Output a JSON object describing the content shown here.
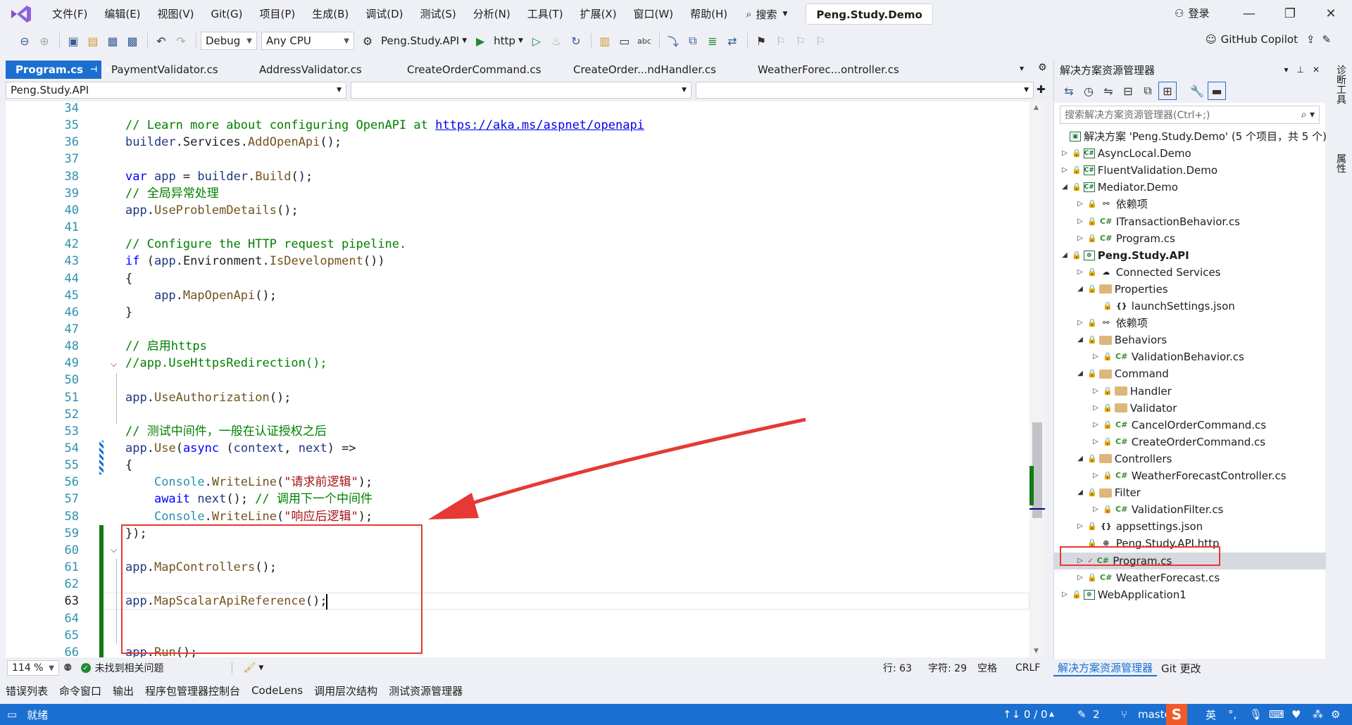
{
  "menubar": {
    "items": [
      "文件(F)",
      "编辑(E)",
      "视图(V)",
      "Git(G)",
      "项目(P)",
      "生成(B)",
      "调试(D)",
      "测试(S)",
      "分析(N)",
      "工具(T)",
      "扩展(X)",
      "窗口(W)",
      "帮助(H)"
    ],
    "search_label": "搜索",
    "solution_name": "Peng.Study.Demo",
    "login_label": "登录"
  },
  "toolbar": {
    "config": "Debug",
    "platform": "Any CPU",
    "startup_project": "Peng.Study.API",
    "launch_profile": "http",
    "copilot_label": "GitHub Copilot"
  },
  "tabs": [
    {
      "label": "Program.cs",
      "active": true
    },
    {
      "label": "PaymentValidator.cs"
    },
    {
      "label": "AddressValidator.cs"
    },
    {
      "label": "CreateOrderCommand.cs"
    },
    {
      "label": "CreateOrder...ndHandler.cs"
    },
    {
      "label": "WeatherForec...ontroller.cs"
    }
  ],
  "navbar": {
    "project": "Peng.Study.API",
    "type": "",
    "member": ""
  },
  "code": {
    "lines": [
      {
        "n": "34",
        "t": []
      },
      {
        "n": "35",
        "t": [
          [
            "cm",
            "// Learn more about configuring OpenAPI at "
          ],
          [
            "ln2",
            "https://aka.ms/aspnet/openapi"
          ]
        ]
      },
      {
        "n": "36",
        "t": [
          [
            "vr",
            "builder"
          ],
          [
            "pl",
            "."
          ],
          [
            "pl",
            "Services"
          ],
          [
            "pl",
            "."
          ],
          [
            "mt",
            "AddOpenApi"
          ],
          [
            "pl",
            "();"
          ]
        ]
      },
      {
        "n": "37",
        "t": []
      },
      {
        "n": "38",
        "t": [
          [
            "kw",
            "var"
          ],
          [
            "pl",
            " "
          ],
          [
            "vr",
            "app"
          ],
          [
            "pl",
            " = "
          ],
          [
            "vr",
            "builder"
          ],
          [
            "pl",
            "."
          ],
          [
            "mt",
            "Build"
          ],
          [
            "pl",
            "();"
          ]
        ]
      },
      {
        "n": "39",
        "t": [
          [
            "cm",
            "// 全局异常处理"
          ]
        ]
      },
      {
        "n": "40",
        "t": [
          [
            "vr",
            "app"
          ],
          [
            "pl",
            "."
          ],
          [
            "mt",
            "UseProblemDetails"
          ],
          [
            "pl",
            "();"
          ]
        ]
      },
      {
        "n": "41",
        "t": []
      },
      {
        "n": "42",
        "t": [
          [
            "cm",
            "// Configure the HTTP request pipeline."
          ]
        ]
      },
      {
        "n": "43",
        "t": [
          [
            "kw",
            "if"
          ],
          [
            "pl",
            " ("
          ],
          [
            "vr",
            "app"
          ],
          [
            "pl",
            "."
          ],
          [
            "pl",
            "Environment"
          ],
          [
            "pl",
            "."
          ],
          [
            "mt",
            "IsDevelopment"
          ],
          [
            "pl",
            "())"
          ]
        ]
      },
      {
        "n": "44",
        "t": [
          [
            "pl",
            "{"
          ]
        ]
      },
      {
        "n": "45",
        "t": [
          [
            "pl",
            "    "
          ],
          [
            "vr",
            "app"
          ],
          [
            "pl",
            "."
          ],
          [
            "mt",
            "MapOpenApi"
          ],
          [
            "pl",
            "();"
          ]
        ]
      },
      {
        "n": "46",
        "t": [
          [
            "pl",
            "}"
          ]
        ]
      },
      {
        "n": "47",
        "t": []
      },
      {
        "n": "48",
        "t": [
          [
            "cm",
            "// 启用https"
          ]
        ]
      },
      {
        "n": "49",
        "t": [
          [
            "cm",
            "//app.UseHttpsRedirection();"
          ]
        ]
      },
      {
        "n": "50",
        "t": []
      },
      {
        "n": "51",
        "t": [
          [
            "vr",
            "app"
          ],
          [
            "pl",
            "."
          ],
          [
            "mt",
            "UseAuthorization"
          ],
          [
            "pl",
            "();"
          ]
        ]
      },
      {
        "n": "52",
        "t": []
      },
      {
        "n": "53",
        "t": [
          [
            "cm",
            "// 测试中间件，一般在认证授权之后"
          ]
        ]
      },
      {
        "n": "54",
        "t": [
          [
            "vr",
            "app"
          ],
          [
            "pl",
            "."
          ],
          [
            "mt",
            "Use"
          ],
          [
            "pl",
            "("
          ],
          [
            "kw",
            "async"
          ],
          [
            "pl",
            " ("
          ],
          [
            "vr",
            "context"
          ],
          [
            "pl",
            ", "
          ],
          [
            "vr",
            "next"
          ],
          [
            "pl",
            ") =>"
          ]
        ]
      },
      {
        "n": "55",
        "t": [
          [
            "pl",
            "{"
          ]
        ]
      },
      {
        "n": "56",
        "t": [
          [
            "pl",
            "    "
          ],
          [
            "ty",
            "Console"
          ],
          [
            "pl",
            "."
          ],
          [
            "mt",
            "WriteLine"
          ],
          [
            "pl",
            "("
          ],
          [
            "st",
            "\"请求前逻辑\""
          ],
          [
            "pl",
            ");"
          ]
        ]
      },
      {
        "n": "57",
        "t": [
          [
            "pl",
            "    "
          ],
          [
            "kw",
            "await"
          ],
          [
            "pl",
            " "
          ],
          [
            "vr",
            "next"
          ],
          [
            "pl",
            "(); "
          ],
          [
            "cm",
            "// 调用下一个中间件"
          ]
        ]
      },
      {
        "n": "58",
        "t": [
          [
            "pl",
            "    "
          ],
          [
            "ty",
            "Console"
          ],
          [
            "pl",
            "."
          ],
          [
            "mt",
            "WriteLine"
          ],
          [
            "pl",
            "("
          ],
          [
            "st",
            "\"响应后逻辑\""
          ],
          [
            "pl",
            ");"
          ]
        ]
      },
      {
        "n": "59",
        "t": [
          [
            "pl",
            "});"
          ]
        ]
      },
      {
        "n": "60",
        "t": []
      },
      {
        "n": "61",
        "t": [
          [
            "vr",
            "app"
          ],
          [
            "pl",
            "."
          ],
          [
            "mt",
            "MapControllers"
          ],
          [
            "pl",
            "();"
          ]
        ]
      },
      {
        "n": "62",
        "t": []
      },
      {
        "n": "63",
        "t": [
          [
            "vr",
            "app"
          ],
          [
            "pl",
            "."
          ],
          [
            "mt",
            "MapScalarApiReference"
          ],
          [
            "pl",
            "();"
          ]
        ]
      },
      {
        "n": "64",
        "t": []
      },
      {
        "n": "65",
        "t": []
      },
      {
        "n": "66",
        "t": [
          [
            "vr",
            "app"
          ],
          [
            "pl",
            "."
          ],
          [
            "mt",
            "Run"
          ],
          [
            "pl",
            "();"
          ]
        ]
      }
    ]
  },
  "editor_status": {
    "zoom": "114 %",
    "issues": "未找到相关问题",
    "line": "行: 63",
    "col": "字符: 29",
    "spaces": "空格",
    "eol": "CRLF"
  },
  "bottom_tabs": [
    "错误列表",
    "命令窗口",
    "输出",
    "程序包管理器控制台",
    "CodeLens",
    "调用层次结构",
    "测试资源管理器"
  ],
  "statusbar": {
    "ready": "就绪",
    "sync": "↑↓ 0 / 0",
    "edits": "2",
    "branch": "master",
    "ime": "英"
  },
  "solution_explorer": {
    "title": "解决方案资源管理器",
    "search_placeholder": "搜索解决方案资源管理器(Ctrl+;)",
    "tree": [
      {
        "depth": 0,
        "exp": "",
        "icon": "sln",
        "label": "解决方案 'Peng.Study.Demo' (5 个项目，共 5 个)"
      },
      {
        "depth": 0,
        "exp": "▷",
        "icon": "proj",
        "label": "AsyncLocal.Demo"
      },
      {
        "depth": 0,
        "exp": "▷",
        "icon": "proj",
        "label": "FluentValidation.Demo"
      },
      {
        "depth": 0,
        "exp": "◢",
        "icon": "proj",
        "label": "Mediator.Demo"
      },
      {
        "depth": 1,
        "exp": "▷",
        "icon": "dep",
        "label": "依赖项"
      },
      {
        "depth": 1,
        "exp": "▷",
        "icon": "cs",
        "label": "ITransactionBehavior.cs"
      },
      {
        "depth": 1,
        "exp": "▷",
        "icon": "cs",
        "label": "Program.cs"
      },
      {
        "depth": 0,
        "exp": "◢",
        "icon": "web",
        "label": "Peng.Study.API",
        "bold": true
      },
      {
        "depth": 1,
        "exp": "▷",
        "icon": "svc",
        "label": "Connected Services"
      },
      {
        "depth": 1,
        "exp": "◢",
        "icon": "folder",
        "label": "Properties"
      },
      {
        "depth": 2,
        "exp": "",
        "icon": "json",
        "label": "launchSettings.json"
      },
      {
        "depth": 1,
        "exp": "▷",
        "icon": "dep",
        "label": "依赖项"
      },
      {
        "depth": 1,
        "exp": "◢",
        "icon": "folder",
        "label": "Behaviors"
      },
      {
        "depth": 2,
        "exp": "▷",
        "icon": "cs",
        "label": "ValidationBehavior.cs"
      },
      {
        "depth": 1,
        "exp": "◢",
        "icon": "folder",
        "label": "Command"
      },
      {
        "depth": 2,
        "exp": "▷",
        "icon": "folder",
        "label": "Handler"
      },
      {
        "depth": 2,
        "exp": "▷",
        "icon": "folder",
        "label": "Validator"
      },
      {
        "depth": 2,
        "exp": "▷",
        "icon": "cs",
        "label": "CancelOrderCommand.cs"
      },
      {
        "depth": 2,
        "exp": "▷",
        "icon": "cs",
        "label": "CreateOrderCommand.cs"
      },
      {
        "depth": 1,
        "exp": "◢",
        "icon": "folder",
        "label": "Controllers"
      },
      {
        "depth": 2,
        "exp": "▷",
        "icon": "cs",
        "label": "WeatherForecastController.cs"
      },
      {
        "depth": 1,
        "exp": "◢",
        "icon": "folder",
        "label": "Filter"
      },
      {
        "depth": 2,
        "exp": "▷",
        "icon": "cs",
        "label": "ValidationFilter.cs"
      },
      {
        "depth": 1,
        "exp": "▷",
        "icon": "json",
        "label": "appsettings.json"
      },
      {
        "depth": 1,
        "exp": "",
        "icon": "http",
        "label": "Peng.Study.API.http"
      },
      {
        "depth": 1,
        "exp": "▷",
        "icon": "cs",
        "label": "Program.cs",
        "selected": true
      },
      {
        "depth": 1,
        "exp": "▷",
        "icon": "cs",
        "label": "WeatherForecast.cs"
      },
      {
        "depth": 0,
        "exp": "▷",
        "icon": "web",
        "label": "WebApplication1"
      }
    ],
    "bottom_tabs": [
      "解决方案资源管理器",
      "Git 更改"
    ]
  },
  "right_rail": [
    "诊断工具",
    "属性"
  ],
  "colors": {
    "accent": "#1b6fd1",
    "annotation": "#e53935"
  }
}
